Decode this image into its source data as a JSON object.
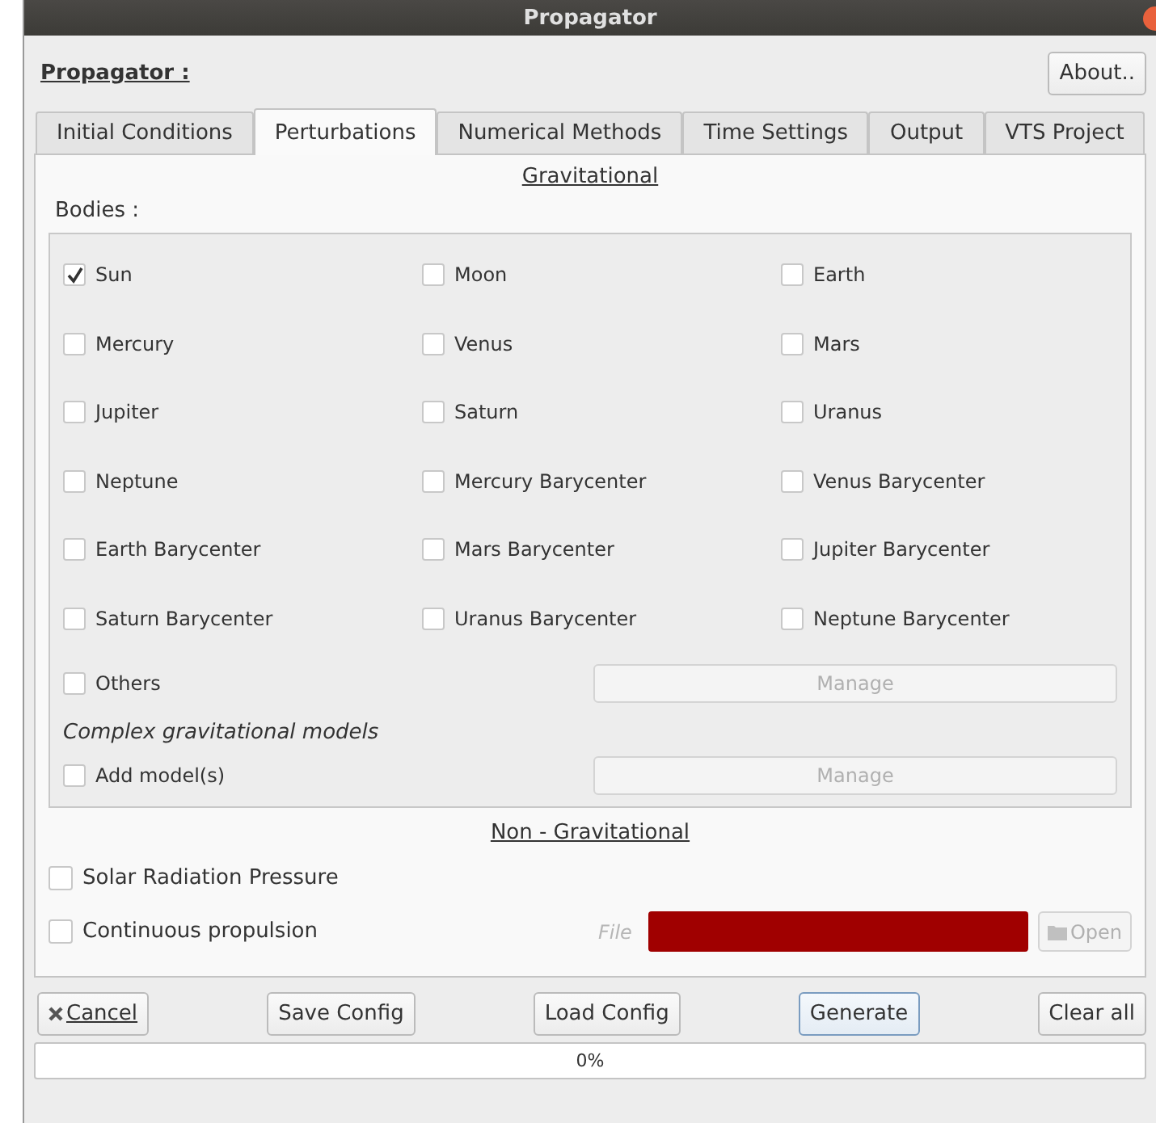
{
  "window": {
    "title": "Propagator"
  },
  "header": {
    "title": "Propagator :",
    "about_button": "About.."
  },
  "tabs": [
    {
      "label": "Initial Conditions",
      "selected": false
    },
    {
      "label": "Perturbations",
      "selected": true
    },
    {
      "label": "Numerical Methods",
      "selected": false
    },
    {
      "label": "Time Settings",
      "selected": false
    },
    {
      "label": "Output",
      "selected": false
    },
    {
      "label": "VTS Project",
      "selected": false
    }
  ],
  "gravitational": {
    "heading": "Gravitational",
    "bodies_label": "Bodies :",
    "bodies": [
      {
        "label": "Sun",
        "checked": true
      },
      {
        "label": "Moon",
        "checked": false
      },
      {
        "label": "Earth",
        "checked": false
      },
      {
        "label": "Mercury",
        "checked": false
      },
      {
        "label": "Venus",
        "checked": false
      },
      {
        "label": "Mars",
        "checked": false
      },
      {
        "label": "Jupiter",
        "checked": false
      },
      {
        "label": "Saturn",
        "checked": false
      },
      {
        "label": "Uranus",
        "checked": false
      },
      {
        "label": "Neptune",
        "checked": false
      },
      {
        "label": "Mercury Barycenter",
        "checked": false
      },
      {
        "label": "Venus Barycenter",
        "checked": false
      },
      {
        "label": "Earth Barycenter",
        "checked": false
      },
      {
        "label": "Mars Barycenter",
        "checked": false
      },
      {
        "label": "Jupiter Barycenter",
        "checked": false
      },
      {
        "label": "Saturn Barycenter",
        "checked": false
      },
      {
        "label": "Uranus Barycenter",
        "checked": false
      },
      {
        "label": "Neptune Barycenter",
        "checked": false
      }
    ],
    "others": {
      "label": "Others",
      "checked": false,
      "button": "Manage",
      "disabled": true
    },
    "complex_heading": "Complex gravitational models",
    "add_models": {
      "label": "Add model(s)",
      "checked": false,
      "button": "Manage",
      "disabled": true
    }
  },
  "non_gravitational": {
    "heading": "Non - Gravitational",
    "solar_radiation": {
      "label": "Solar Radiation Pressure",
      "checked": false
    },
    "propulsion": {
      "label": "Continuous propulsion",
      "checked": false,
      "file_label": "File",
      "file_valid": false,
      "open_button": "Open",
      "open_disabled": true
    }
  },
  "buttons": [
    "Cancel",
    "Save Config",
    "Load Config",
    "Generate",
    "Clear all"
  ],
  "progress": {
    "level": 0,
    "text": "0%"
  }
}
